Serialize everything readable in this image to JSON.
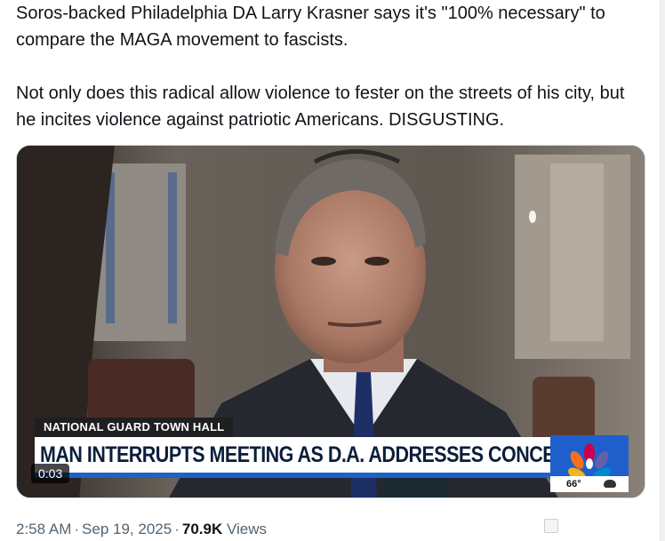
{
  "tweet": {
    "text_line1": "Soros-backed Philadelphia DA Larry Krasner says it's \"100% necessary\" to compare the MAGA movement to fascists.",
    "text_line2": "Not only does this radical allow violence to fester on the streets of his city, but he incites violence against patriotic Americans. DISGUSTING."
  },
  "video": {
    "kicker": "NATIONAL GUARD TOWN HALL",
    "headline": "MAN INTERRUPTS MEETING AS D.A. ADDRESSES CONCERNS",
    "weather_temp": "66°",
    "timestamp": "0:03",
    "logo_icon": "nbc-peacock-icon",
    "weather_icon": "cloud-icon"
  },
  "meta": {
    "time": "2:58 AM",
    "date": "Sep 19, 2025",
    "separator": "·",
    "views_count": "70.9K",
    "views_label": "Views"
  },
  "colors": {
    "text": "#0f1419",
    "muted": "#536471",
    "lower_third_blue": "#1b63c9",
    "logo_blue": "#1e5fcc"
  }
}
